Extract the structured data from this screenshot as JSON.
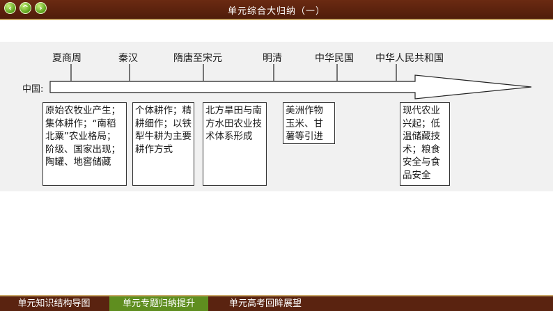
{
  "nav": {
    "back_icon": "‹",
    "home_icon": "^",
    "forward_icon": "›"
  },
  "title": "单元综合大归纳（一）",
  "timeline": {
    "label": "中国:",
    "periods": [
      "夏商周",
      "秦汉",
      "隋唐至宋元",
      "明清",
      "中华民国",
      "中华人民共和国"
    ],
    "boxes": [
      "原始农牧业产生；集体耕作；“南稻北粟”农业格局；阶级、国家出现；陶罐、地窖储藏",
      "个体耕作；精耕细作；以铁犁牛耕为主要耕作方式",
      "北方旱田与南方水田农业技术体系形成",
      "美洲作物玉米、甘薯等引进",
      "现代农业兴起；低温储藏技术；粮食安全与食品安全"
    ]
  },
  "bottom_tabs": [
    "单元知识结构导图",
    "单元专题归纳提升",
    "单元高考回眸展望"
  ]
}
